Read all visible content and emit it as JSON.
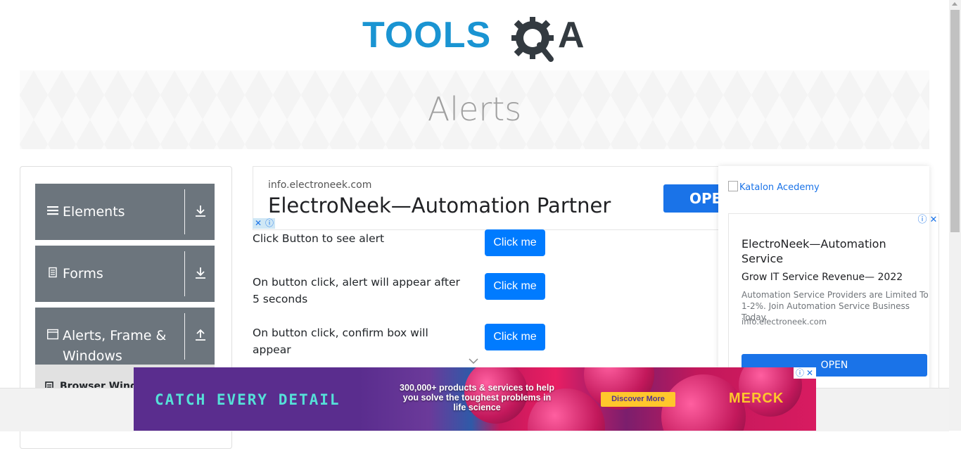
{
  "header": {
    "logo_tools": "TOOLS",
    "logo_qa_letter": "A"
  },
  "banner": {
    "title": "Alerts"
  },
  "sidebar": {
    "groups": [
      {
        "label": "Elements",
        "icon": "hamburger-icon",
        "arrow": "download-arrow-icon"
      },
      {
        "label": "Forms",
        "icon": "document-icon",
        "arrow": "download-arrow-icon"
      },
      {
        "label": "Alerts, Frame &",
        "label2": "Windows",
        "icon": "window-icon",
        "arrow": "upload-arrow-icon"
      }
    ],
    "sub_item": "Browser Windows"
  },
  "top_ad": {
    "domain": "info.electroneek.com",
    "headline": "ElectroNeek—Automation Partner",
    "open": "OPEN"
  },
  "rows": [
    {
      "text": "Click Button to see alert",
      "button": "Click me"
    },
    {
      "text": "On button click, alert will appear after 5 seconds",
      "button": "Click me"
    },
    {
      "text": "On button click, confirm box will appear",
      "button": "Click me"
    }
  ],
  "side_ad": {
    "image_alt": "Katalon Acedemy",
    "title": "ElectroNeek—Automation Service",
    "subtitle": "Grow IT Service Revenue— 2022",
    "body": "Automation Service Providers are Limited To 1-2%. Join Automation Service Business Today.",
    "domain": "info.electroneek.com",
    "open": "OPEN"
  },
  "bottom_ad": {
    "tagline": "CATCH EVERY DETAIL",
    "count": "300,000+",
    "text": "products & services to help you solve the toughest problems in life science",
    "button": "Discover More",
    "brand": "MERCK"
  },
  "colors": {
    "brand_blue": "#1a94d2",
    "sidebar_gray": "#6c757d",
    "button_blue": "#007bff",
    "ad_blue": "#1a73e8"
  }
}
